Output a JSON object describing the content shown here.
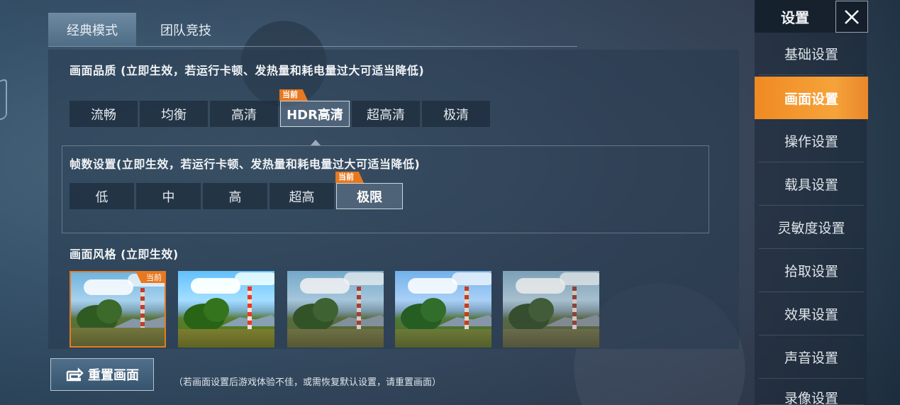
{
  "tabs": [
    {
      "label": "经典模式",
      "active": true
    },
    {
      "label": "团队竞技",
      "active": false
    }
  ],
  "quality": {
    "title": "画面品质 (立即生效，若运行卡顿、发热量和耗电量过大可适当降低)",
    "options": [
      "流畅",
      "均衡",
      "高清",
      "HDR高清",
      "超高清",
      "极清"
    ],
    "selected": "HDR高清",
    "badge": "当前"
  },
  "framerate": {
    "title": "帧数设置(立即生效，若运行卡顿、发热量和耗电量过大可适当降低)",
    "options": [
      "低",
      "中",
      "高",
      "超高",
      "极限"
    ],
    "selected": "极限",
    "badge": "当前"
  },
  "style": {
    "title": "画面风格 (立即生效)",
    "badge": "当前",
    "thumbnail_count": 5,
    "selected_index": 0
  },
  "reset": {
    "label": "重置画面",
    "hint": "（若画面设置后游戏体验不佳，或需恢复默认设置，请重置画面）"
  },
  "sidebar": {
    "title": "设置",
    "items": [
      {
        "label": "基础设置",
        "active": false
      },
      {
        "label": "画面设置",
        "active": true
      },
      {
        "label": "操作设置",
        "active": false
      },
      {
        "label": "载具设置",
        "active": false
      },
      {
        "label": "灵敏度设置",
        "active": false
      },
      {
        "label": "拾取设置",
        "active": false
      },
      {
        "label": "效果设置",
        "active": false
      },
      {
        "label": "声音设置",
        "active": false
      },
      {
        "label": "录像设置",
        "active": false
      }
    ]
  },
  "colors": {
    "accent": "#f08a22",
    "badge": "#e8781f"
  }
}
